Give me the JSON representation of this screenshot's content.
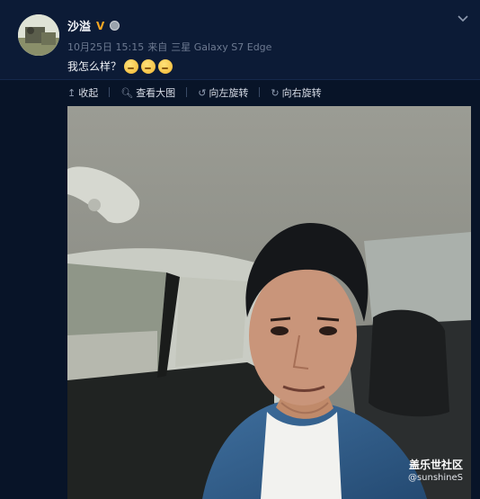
{
  "post": {
    "author": "沙溢",
    "verified_badge": "V",
    "date": "10月25日 15:15",
    "source_prefix": "来自",
    "device": "三星 Galaxy S7 Edge",
    "text": "我怎么样？",
    "emoji_count": 3
  },
  "actions": [
    {
      "icon": "arrow-up-icon",
      "label": "收起"
    },
    {
      "icon": "magnifier-icon",
      "label": "查看大图"
    },
    {
      "icon": "rotate-left-icon",
      "label": "向左旋转"
    },
    {
      "icon": "rotate-right-icon",
      "label": "向右旋转"
    }
  ],
  "watermark": {
    "line1": "盖乐世社区",
    "line2": "@sunshineS"
  },
  "colors": {
    "background": "#0a1a33",
    "verified": "#f5a623",
    "meta_text": "#6d7a91"
  }
}
